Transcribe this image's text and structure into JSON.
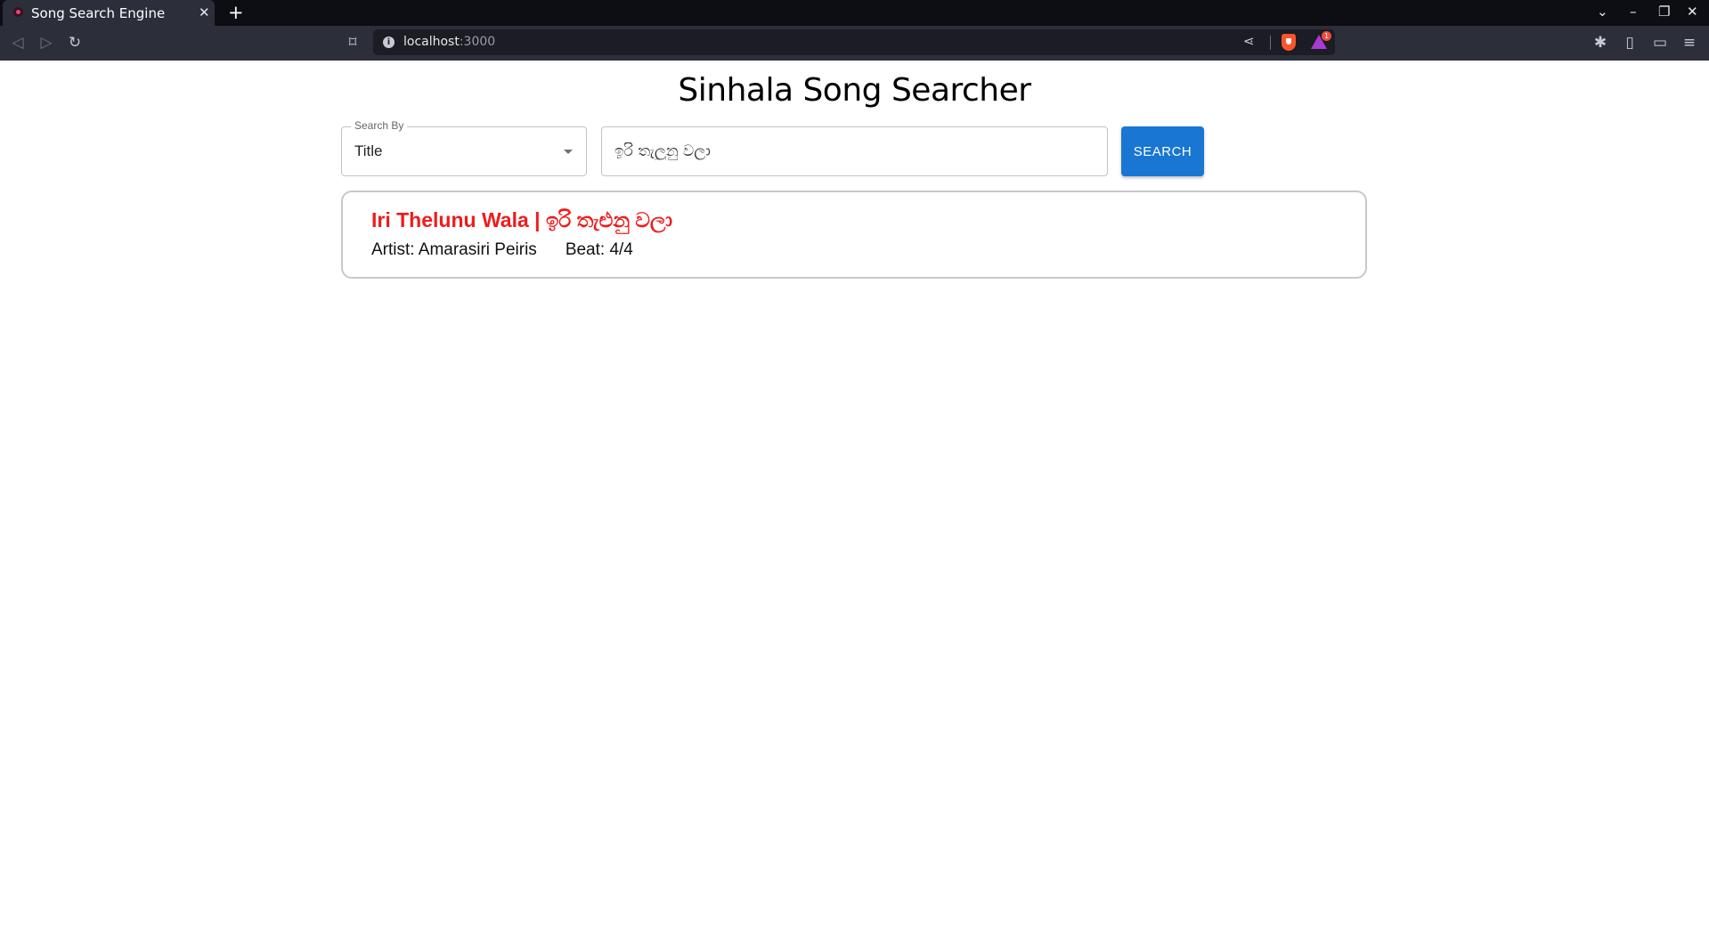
{
  "browser": {
    "tab_title": "Song Search Engine",
    "tab_close": "✕",
    "new_tab": "+",
    "url_host": "localhost",
    "url_port": ":3000",
    "rewards_count": "1",
    "window_controls": {
      "list": "⌄",
      "minimize": "–",
      "restore": "❐",
      "close": "✕"
    },
    "toolbar_glyphs": {
      "back": "◁",
      "forward": "▷",
      "reload": "↻",
      "bookmark": "⌑",
      "info": "i",
      "share": "⋖",
      "extensions": "✱",
      "sidebar": "▯",
      "wallet": "▭",
      "menu": "≡"
    }
  },
  "page": {
    "title": "Sinhala Song Searcher",
    "search_by": {
      "label": "Search By",
      "selected": "Title"
    },
    "search_input": {
      "value": "ඉරි තැලුනු වලා"
    },
    "search_button": "SEARCH"
  },
  "results": [
    {
      "title": "Iri Thelunu Wala | ඉරි තැළුනු වලා",
      "artist": "Artist: Amarasiri Peiris",
      "beat": "Beat: 4/4"
    }
  ],
  "colors": {
    "primary_button": "#1976d2",
    "result_title": "#ee1c1c",
    "chrome_dark": "#0d0e14",
    "chrome_toolbar": "#2c2e3a"
  },
  "icons": [
    "favicon-icon",
    "close-icon",
    "plus-icon",
    "chevron-down-icon",
    "minimize-icon",
    "restore-icon",
    "back-icon",
    "forward-icon",
    "reload-icon",
    "bookmark-icon",
    "info-icon",
    "share-icon",
    "brave-shields-icon",
    "brave-rewards-icon",
    "extensions-icon",
    "sidebar-icon",
    "wallet-icon",
    "menu-icon",
    "dropdown-caret-icon"
  ]
}
